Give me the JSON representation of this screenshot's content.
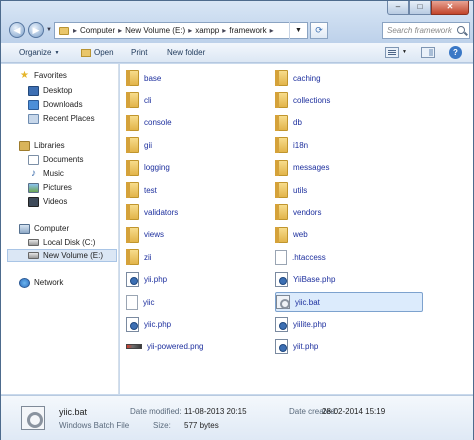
{
  "address": {
    "crumbs": [
      "Computer",
      "New Volume (E:)",
      "xampp",
      "framework"
    ],
    "search_placeholder": "Search framework"
  },
  "toolbar": {
    "organize": "Organize",
    "open": "Open",
    "print": "Print",
    "new_folder": "New folder"
  },
  "nav": {
    "favorites": "Favorites",
    "desktop": "Desktop",
    "downloads": "Downloads",
    "recent": "Recent Places",
    "libraries": "Libraries",
    "documents": "Documents",
    "music": "Music",
    "pictures": "Pictures",
    "videos": "Videos",
    "computer": "Computer",
    "local_disk": "Local Disk (C:)",
    "new_volume": "New Volume (E:)",
    "network": "Network"
  },
  "files": {
    "left": [
      {
        "name": "base",
        "icon": "folder-icon"
      },
      {
        "name": "cli",
        "icon": "folder-icon"
      },
      {
        "name": "console",
        "icon": "folder-icon"
      },
      {
        "name": "gii",
        "icon": "folder-icon"
      },
      {
        "name": "logging",
        "icon": "folder-icon"
      },
      {
        "name": "test",
        "icon": "folder-icon"
      },
      {
        "name": "validators",
        "icon": "folder-icon"
      },
      {
        "name": "views",
        "icon": "folder-icon"
      },
      {
        "name": "zii",
        "icon": "folder-icon"
      },
      {
        "name": "yii.php",
        "icon": "php-file-icon"
      },
      {
        "name": "yiic",
        "icon": "plain-file-icon"
      },
      {
        "name": "yiic.php",
        "icon": "php-file-icon"
      },
      {
        "name": "yii-powered.png",
        "icon": "png-file-icon"
      }
    ],
    "right": [
      {
        "name": "caching",
        "icon": "folder-icon"
      },
      {
        "name": "collections",
        "icon": "folder-icon"
      },
      {
        "name": "db",
        "icon": "folder-icon"
      },
      {
        "name": "i18n",
        "icon": "folder-icon"
      },
      {
        "name": "messages",
        "icon": "folder-icon"
      },
      {
        "name": "utils",
        "icon": "folder-icon"
      },
      {
        "name": "vendors",
        "icon": "folder-icon"
      },
      {
        "name": "web",
        "icon": "folder-icon"
      },
      {
        "name": ".htaccess",
        "icon": "plain-file-icon"
      },
      {
        "name": "YiiBase.php",
        "icon": "php-file-icon"
      },
      {
        "name": "yiic.bat",
        "icon": "bat-file-icon",
        "selected": true
      },
      {
        "name": "yiilite.php",
        "icon": "php-file-icon"
      },
      {
        "name": "yiit.php",
        "icon": "php-file-icon"
      }
    ]
  },
  "details": {
    "name": "yiic.bat",
    "type": "Windows Batch File",
    "modified_label": "Date modified:",
    "modified_value": "11-08-2013 20:15",
    "size_label": "Size:",
    "size_value": "577 bytes",
    "created_label": "Date created:",
    "created_value": "28-02-2014 15:19"
  }
}
